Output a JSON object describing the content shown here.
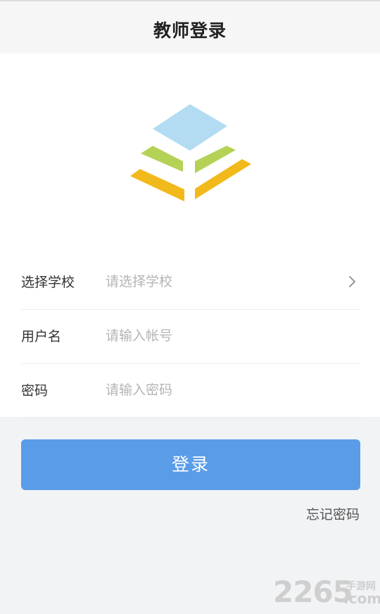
{
  "header": {
    "title": "教师登录"
  },
  "logo": {
    "icon": "pyramid-logo-icon",
    "colors": {
      "top": "#b3dcf2",
      "middle": "#b5d256",
      "bottom": "#f2b91a"
    }
  },
  "form": {
    "school": {
      "label": "选择学校",
      "placeholder": "请选择学校",
      "value": "",
      "icon": "chevron-right-icon"
    },
    "username": {
      "label": "用户名",
      "placeholder": "请输入帐号",
      "value": ""
    },
    "password": {
      "label": "密码",
      "placeholder": "请输入密码",
      "value": ""
    }
  },
  "actions": {
    "login_label": "登录",
    "forgot_label": "忘记密码"
  },
  "watermark": {
    "number": "2265",
    "top": "手游网",
    "bottom": ".com"
  },
  "colors": {
    "accent": "#5a9ce8",
    "background": "#f2f3f5",
    "panel": "#ffffff"
  }
}
